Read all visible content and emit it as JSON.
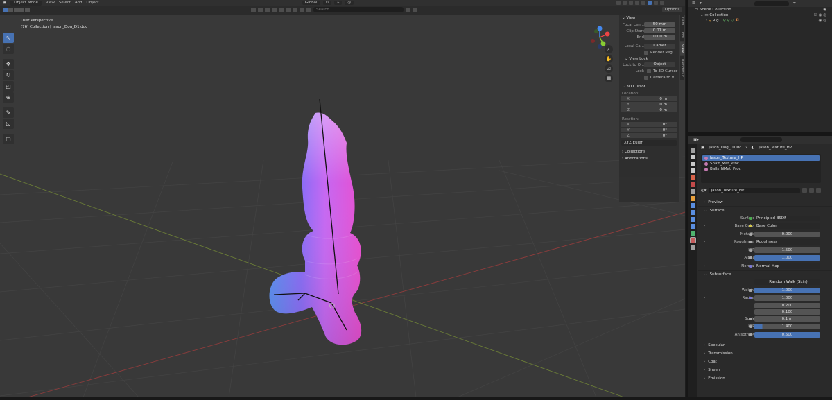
{
  "header": {
    "mode": "Object Mode",
    "menus": [
      "View",
      "Select",
      "Add",
      "Object"
    ],
    "transform_orientation": "Global",
    "search_placeholder": "Search",
    "options": "Options"
  },
  "viewport": {
    "perspective": "User Perspective",
    "collection_info": "(76) Collection | Jason_Dog_D1lddc"
  },
  "npanel": {
    "view_title": "View",
    "focal_label": "Focal Len...",
    "focal_value": "50 mm",
    "clip_start_label": "Clip Start",
    "clip_start_value": "0.01 m",
    "clip_end_label": "End",
    "clip_end_value": "1000 m",
    "local_camera_label": "Local Ca...",
    "local_camera_value": "Camer",
    "render_region": "Render Regi...",
    "view_lock_title": "View Lock",
    "lock_to_object_label": "Lock to O...",
    "lock_to_object_value": "Object",
    "lock_label": "Lock",
    "to_3d_cursor": "To 3D Cursor",
    "camera_to_view": "Camera to V...",
    "cursor_title": "3D Cursor",
    "location_label": "Location:",
    "rotation_label": "Rotation:",
    "loc": [
      {
        "a": "X",
        "v": "0 m"
      },
      {
        "a": "Y",
        "v": "0 m"
      },
      {
        "a": "Z",
        "v": "0 m"
      }
    ],
    "rot": [
      {
        "a": "X",
        "v": "0°"
      },
      {
        "a": "Y",
        "v": "0°"
      },
      {
        "a": "Z",
        "v": "0°"
      }
    ],
    "rotation_mode": "XYZ Euler",
    "collections": "Collections",
    "annotations": "Annotations",
    "tabs": [
      "Item",
      "Tool",
      "View",
      "BlenderKit"
    ]
  },
  "outliner": {
    "scene_collection": "Scene Collection",
    "collection": "Collection",
    "rig": "Rig"
  },
  "properties": {
    "breadcrumb_object": "Jason_Dog_D1ldc",
    "breadcrumb_material": "Jason_Texture_HP",
    "slots": [
      "Jason_Texture_HP",
      "Shaft_Mat_Proc",
      "Balls_NMat_Proc"
    ],
    "material_name": "Jason_Texture_HP",
    "preview": "Preview",
    "surface": "Surface",
    "rows": {
      "surface_label": "Surface",
      "surface_value": "Principled BSDF",
      "base_color_label": "Base Color",
      "base_color_value": "Base Color",
      "metallic_label": "Metallic",
      "metallic_value": "0.000",
      "roughness_label": "Roughness",
      "roughness_value": "Roughness",
      "ior_label": "IOR",
      "ior_value": "1.500",
      "alpha_label": "Alpha",
      "alpha_value": "1.000",
      "normal_label": "Normal",
      "normal_value": "Normal Map"
    },
    "subsurface": "Subsurface",
    "sss": {
      "method": "Random Walk (Skin)",
      "weight_label": "Weight",
      "weight_value": "1.000",
      "radius_label": "Radius",
      "radius_values": [
        "1.000",
        "0.200",
        "0.100"
      ],
      "scale_label": "Scale",
      "scale_value": "0.1 m",
      "ior_label": "IOR",
      "ior_value": "1.400",
      "anisotropy_label": "Anisotropy",
      "anisotropy_value": "0.500"
    },
    "closed_sections": [
      "Specular",
      "Transmission",
      "Coat",
      "Sheen",
      "Emission"
    ]
  }
}
